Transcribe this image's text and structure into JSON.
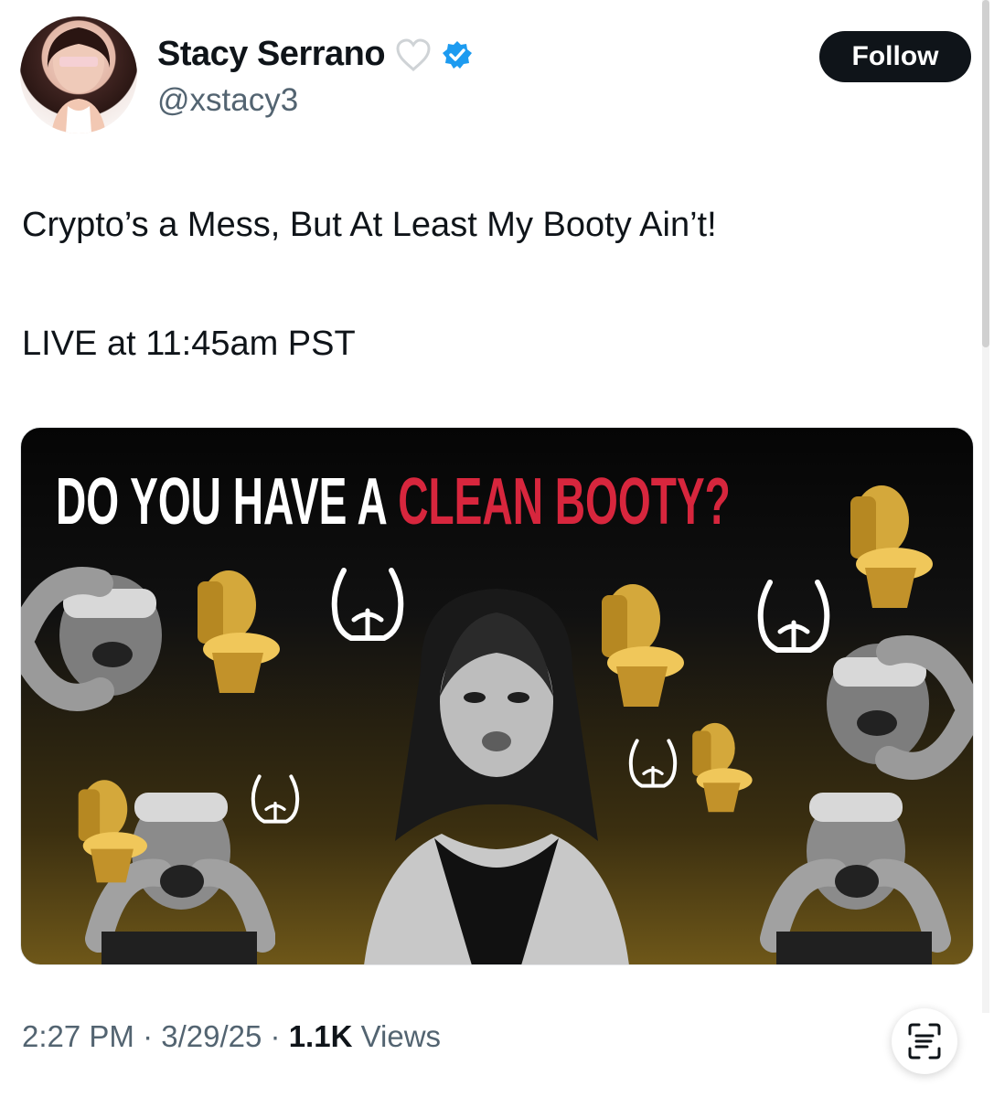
{
  "author": {
    "name": "Stacy Serrano",
    "handle": "@xstacy3"
  },
  "actions": {
    "follow_label": "Follow"
  },
  "tweet": {
    "line1": "Crypto’s a Mess, But At Least My Booty Ain’t!",
    "line2": "LIVE at 11:45am PST"
  },
  "media": {
    "title_white": "DO YOU HAVE A",
    "title_red": "CLEAN BOOTY?",
    "colors": {
      "title_white": "#ffffff",
      "title_red": "#d7263d",
      "gold": "#d4a83b"
    }
  },
  "footer": {
    "time": "2:27 PM",
    "date": "3/29/25",
    "views_count": "1.1K",
    "views_label": "Views"
  },
  "icons": {
    "heart": "heart-icon",
    "verified": "verified-icon",
    "scan": "scan-icon"
  }
}
